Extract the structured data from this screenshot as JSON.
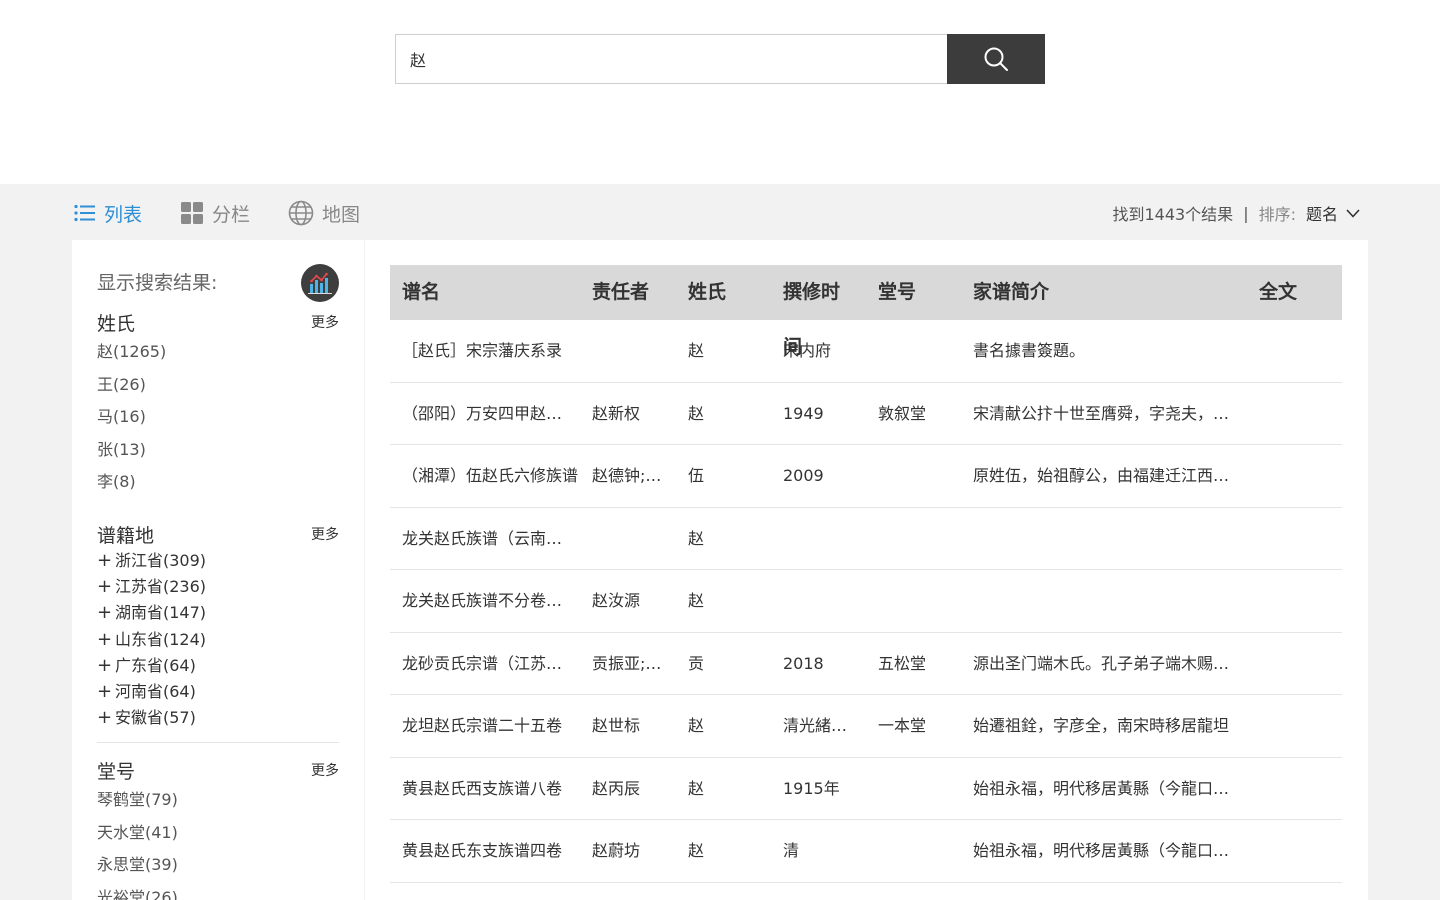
{
  "search": {
    "query": "赵"
  },
  "views": {
    "list": "列表",
    "columns": "分栏",
    "map": "地图"
  },
  "results": {
    "summary": "找到1443个结果",
    "separator": "|",
    "sort_label": "排序:",
    "sort_value": "题名"
  },
  "sidebar": {
    "title": "显示搜索结果:",
    "facets": [
      {
        "name": "姓氏",
        "more": "更多",
        "items": [
          "赵(1265)",
          "王(26)",
          "马(16)",
          "张(13)",
          "李(8)"
        ]
      },
      {
        "name": "谱籍地",
        "more": "更多",
        "items": [
          "浙江省(309)",
          "江苏省(236)",
          "湖南省(147)",
          "山东省(124)",
          "广东省(64)",
          "河南省(64)",
          "安徽省(57)"
        ]
      },
      {
        "name": "堂号",
        "more": "更多",
        "items": [
          "琴鹤堂(79)",
          "天水堂(41)",
          "永思堂(39)",
          "光裕堂(26)"
        ]
      }
    ]
  },
  "table": {
    "headers": [
      "谱名",
      "责任者",
      "姓氏",
      "撰修时间",
      "堂号",
      "家谱简介",
      "全文"
    ],
    "rows": [
      [
        "［赵氏］宋宗藩庆系录",
        "",
        "赵",
        "宋内府",
        "",
        "書名據書簽題。",
        ""
      ],
      [
        "（邵阳）万安四甲赵氏族谱",
        "赵新权",
        "赵",
        "1949",
        "敦叙堂",
        "宋清献公抃十世至膺舜，字尧夫，由江西迁居湖南",
        ""
      ],
      [
        "（湘潭）伍赵氏六修族谱",
        "赵德钟;赵德",
        "伍",
        "2009",
        "",
        "原姓伍，始祖醇公，由福建迁江西，再迁湖南湘潭",
        ""
      ],
      [
        "龙关赵氏族谱（云南龙关）",
        "",
        "赵",
        "",
        "",
        "",
        ""
      ],
      [
        "龙关赵氏族谱不分卷（云南）",
        "赵汝源",
        "赵",
        "",
        "",
        "",
        ""
      ],
      [
        "龙砂贡氏宗谱（江苏江阴）",
        "贡振亚;贡新",
        "贡",
        "2018",
        "五松堂",
        "源出圣门端木氏。孔子弟子端木赐，字子贡",
        ""
      ],
      [
        "龙坦赵氏宗谱二十五卷",
        "赵世标",
        "赵",
        "清光緒三十年",
        "一本堂",
        "始遷祖銓，字彦全，南宋時移居龍坦",
        ""
      ],
      [
        "黄县赵氏西支族谱八卷",
        "赵丙辰",
        "赵",
        "1915年",
        "",
        "始祖永福，明代移居黃縣（今龍口市）",
        ""
      ],
      [
        "黄县赵氏东支族谱四卷",
        "赵蔚坊",
        "赵",
        "清",
        "",
        "始祖永福，明代移居黃縣（今龍口市）",
        ""
      ]
    ]
  }
}
